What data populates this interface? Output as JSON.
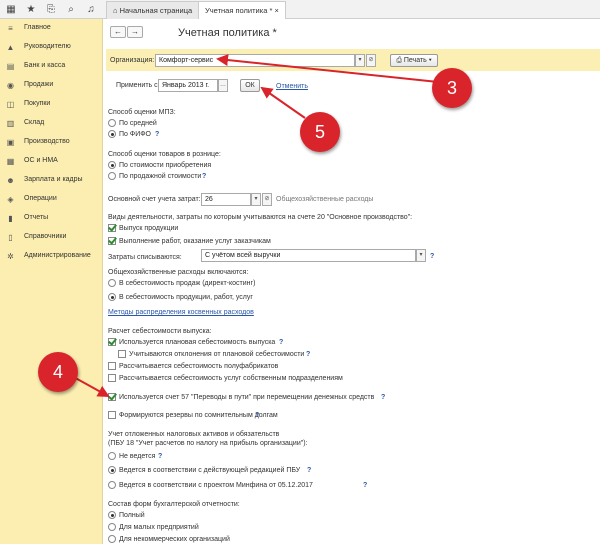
{
  "tabs": [
    {
      "label": "Начальная страница"
    },
    {
      "label": "Учетная политика *"
    }
  ],
  "sidebar": {
    "items": [
      {
        "label": "Главное",
        "icon": "menu-icon"
      },
      {
        "label": "Руководителю",
        "icon": "chart-icon"
      },
      {
        "label": "Банк и касса",
        "icon": "bank-icon"
      },
      {
        "label": "Продажи",
        "icon": "cart-icon"
      },
      {
        "label": "Покупки",
        "icon": "basket-icon"
      },
      {
        "label": "Склад",
        "icon": "warehouse-icon"
      },
      {
        "label": "Производство",
        "icon": "factory-icon"
      },
      {
        "label": "ОС и НМА",
        "icon": "assets-icon"
      },
      {
        "label": "Зарплата и кадры",
        "icon": "people-icon"
      },
      {
        "label": "Операции",
        "icon": "operations-icon"
      },
      {
        "label": "Отчеты",
        "icon": "report-icon"
      },
      {
        "label": "Справочники",
        "icon": "book-icon"
      },
      {
        "label": "Администрирование",
        "icon": "gear-icon"
      }
    ]
  },
  "page": {
    "title": "Учетная политика *"
  },
  "org": {
    "label": "Организация:",
    "value": "Комфорт-сервис",
    "print_label": "Печать"
  },
  "apply": {
    "label": "Применить с:",
    "value": "Январь 2013 г.",
    "ok_label": "ОК",
    "cancel_label": "Отменить"
  },
  "mpz": {
    "title": "Способ оценки МПЗ:",
    "options": [
      "По средней",
      "По ФИФО"
    ],
    "selected": 1
  },
  "retail": {
    "title": "Способ оценки товаров в рознице:",
    "options": [
      "По стоимости приобретения",
      "По продажной стоимости"
    ],
    "selected": 0
  },
  "account": {
    "label": "Основной счет учета затрат:",
    "value": "26",
    "note": "Общехозяйственные расходы"
  },
  "activities": {
    "title": "Виды деятельности, затраты по которым учитываются на счете 20 \"Основное производство\":",
    "items": [
      {
        "label": "Выпуск продукции",
        "checked": true
      },
      {
        "label": "Выполнение работ, оказание услуг заказчикам",
        "checked": true
      }
    ],
    "write_off_label": "Затраты списываются:",
    "write_off_value": "С учётом всей выручки"
  },
  "overhead": {
    "title": "Общехозяйственные расходы включаются:",
    "options": [
      "В себестоимость продаж (директ-костинг)",
      "В  себестоимость продукции, работ, услуг"
    ],
    "selected": 1,
    "link": "Методы распределения косвенных расходов"
  },
  "cost": {
    "title": "Расчет себестоимости выпуска:",
    "items": [
      {
        "label": "Используется плановая себестоимость выпуска",
        "checked": true,
        "help": true
      },
      {
        "label": "Учитываются отклонения от плановой себестоимости",
        "checked": false,
        "help": true
      },
      {
        "label": "Рассчитывается себестоимость полуфабрикатов",
        "checked": false,
        "help": false
      },
      {
        "label": "Рассчитывается себестоимость услуг собственным подразделениям",
        "checked": false,
        "help": false
      }
    ]
  },
  "transit": {
    "label": "Используется счет 57 \"Переводы в пути\" при перемещении денежных средств",
    "checked": true
  },
  "reserves": {
    "label": "Формируются резервы по сомнительным долгам",
    "checked": false
  },
  "deferred": {
    "title1": "Учет отложенных налоговых активов и обязательств",
    "title2": "(ПБУ 18 \"Учет расчетов по налогу на прибыль организации\"):",
    "options": [
      "Не ведется",
      "Ведется в соответствии с действующей редакцией ПБУ",
      "Ведется в соответствии с проектом Минфина от 05.12.2017"
    ],
    "selected": 1
  },
  "forms": {
    "title": "Состав форм бухгалтерской отчетности:",
    "options": [
      "Полный",
      "Для малых предприятий",
      "Для некоммерческих организаций"
    ],
    "selected": 0
  },
  "help_glyph": "?",
  "markers": [
    {
      "number": "3"
    },
    {
      "number": "5"
    },
    {
      "number": "4"
    }
  ],
  "colors": {
    "sidebar": "#fbeeb0",
    "marker": "#d8242a",
    "link": "#2a57a8"
  }
}
